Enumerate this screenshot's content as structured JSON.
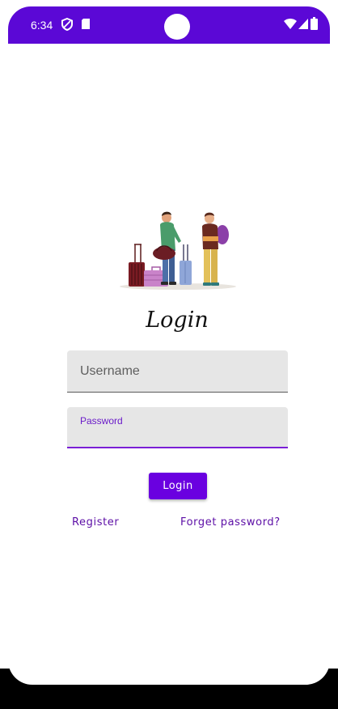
{
  "status_bar": {
    "time": "6:34",
    "icons": [
      "shield-icon",
      "sd-card-icon",
      "wifi-icon",
      "signal-icon",
      "battery-icon"
    ],
    "color": "#5b08d6"
  },
  "illustration": {
    "icon": "travelers-with-luggage-illustration"
  },
  "login_form": {
    "heading": "Login",
    "username": {
      "placeholder": "Username",
      "value": ""
    },
    "password": {
      "label": "Password",
      "value": ""
    },
    "login_button_label": "Login",
    "register_link": "Register",
    "forget_password_link": "Forget password?",
    "accent_color": "#6a00e0"
  }
}
